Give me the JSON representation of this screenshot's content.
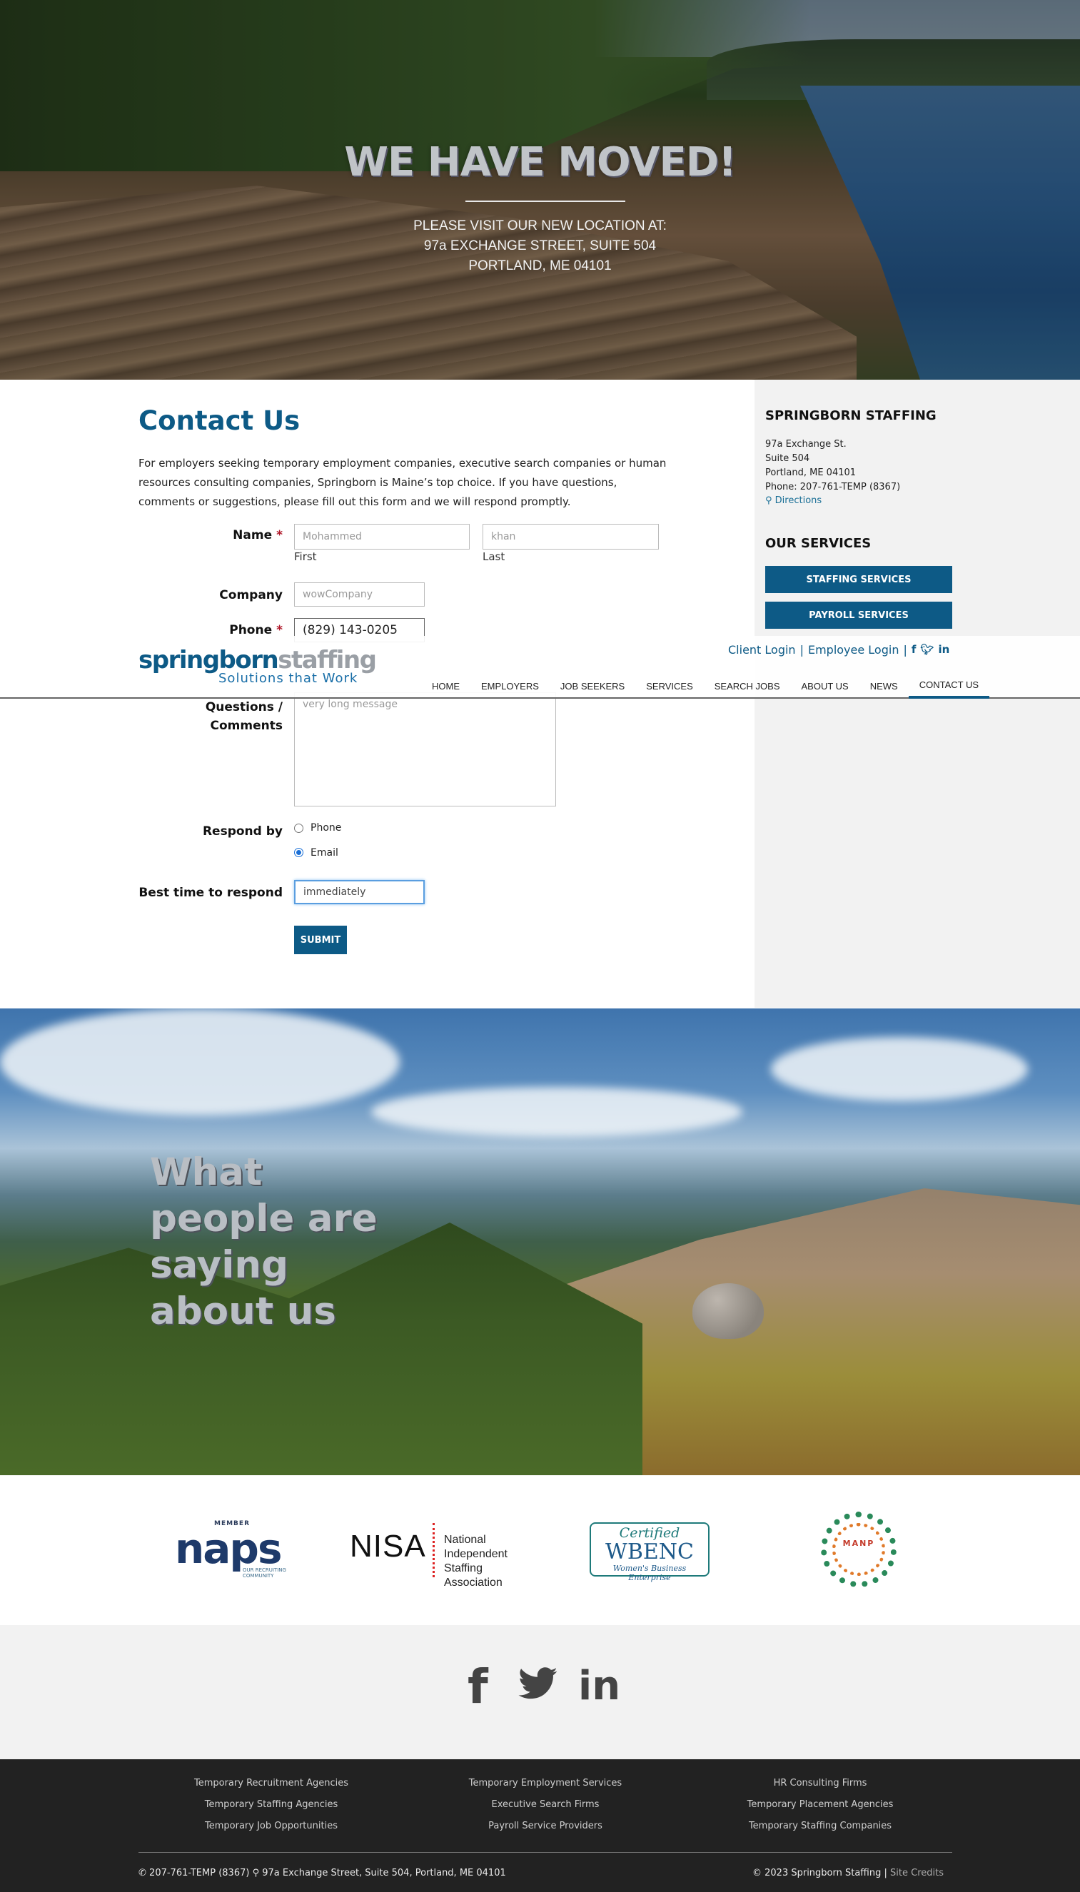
{
  "hero": {
    "title": "WE HAVE MOVED!",
    "line1": "PLEASE VISIT OUR NEW LOCATION AT:",
    "line2": "97a EXCHANGE STREET, SUITE 504",
    "line3": "PORTLAND, ME 04101"
  },
  "header": {
    "logo_blue": "springborn",
    "logo_grey": "staffing",
    "tagline": "Solutions that Work",
    "client_login": "Client Login",
    "separator": "|",
    "employee_login": "Employee Login",
    "nav": [
      "HOME",
      "EMPLOYERS",
      "JOB SEEKERS",
      "SERVICES",
      "SEARCH JOBS",
      "ABOUT US",
      "NEWS",
      "CONTACT US"
    ],
    "active_nav": "CONTACT US"
  },
  "contact": {
    "title": "Contact Us",
    "intro": "For employers seeking temporary employment companies, executive search companies or human resources consulting companies, Springborn is Maine’s top choice. If you have questions, comments or suggestions, please fill out this form and we will respond promptly.",
    "name_label": "Name",
    "required_mark": "*",
    "first_value": "Mohammed",
    "last_value": "khan",
    "first_label": "First",
    "last_label": "Last",
    "company_label": "Company",
    "company_value": "wowCompany",
    "phone_label": "Phone",
    "phone_value": "(829) 143-0205",
    "questions_label_1": "Questions /",
    "questions_label_2": "Comments",
    "questions_value": "very long message",
    "respond_label": "Respond by",
    "respond_options": [
      "Phone",
      "Email"
    ],
    "respond_selected": "Email",
    "besttime_label": "Best time to respond",
    "besttime_value": "immediately",
    "submit_label": "SUBMIT"
  },
  "sidebar": {
    "company_title": "SPRINGBORN STAFFING",
    "address_lines": [
      "97a Exchange St.",
      "Suite 504",
      "Portland, ME 04101",
      "Phone: 207-761-TEMP (8367)"
    ],
    "directions": "Directions",
    "services_title": "OUR SERVICES",
    "buttons": [
      "STAFFING SERVICES",
      "PAYROLL SERVICES"
    ]
  },
  "testimonial": {
    "title": "What people are saying about us"
  },
  "logos": {
    "naps_member": "MEMBER",
    "naps_word": "naps",
    "naps_sub": "OUR RECRUITING COMMUNITY",
    "nisa_word": "NISA",
    "nisa_sub1": "National Independent",
    "nisa_sub2": "Staffing Association",
    "wbenc_cert": "Certified",
    "wbenc_word": "WBENC",
    "wbenc_sub": "Women's Business Enterprise",
    "manp_word": "MANP"
  },
  "footer": {
    "links_col1": [
      "Temporary Recruitment Agencies",
      "Temporary Staffing Agencies",
      "Temporary Job Opportunities"
    ],
    "links_col2": [
      "Temporary Employment Services",
      "Executive Search Firms",
      "Payroll Service Providers"
    ],
    "links_col3": [
      "HR Consulting Firms",
      "Temporary Placement Agencies",
      "Temporary Staffing Companies"
    ],
    "contact_line": "207-761-TEMP (8367)",
    "address_line": "97a Exchange Street, Suite 504, Portland, ME 04101",
    "copyright": "© 2023 Springborn Staffing |",
    "site_credits": "Site Credits"
  },
  "colors": {
    "brand_blue": "#0d5a86",
    "required_red": "#b0182a",
    "footer_bg": "#222222"
  }
}
